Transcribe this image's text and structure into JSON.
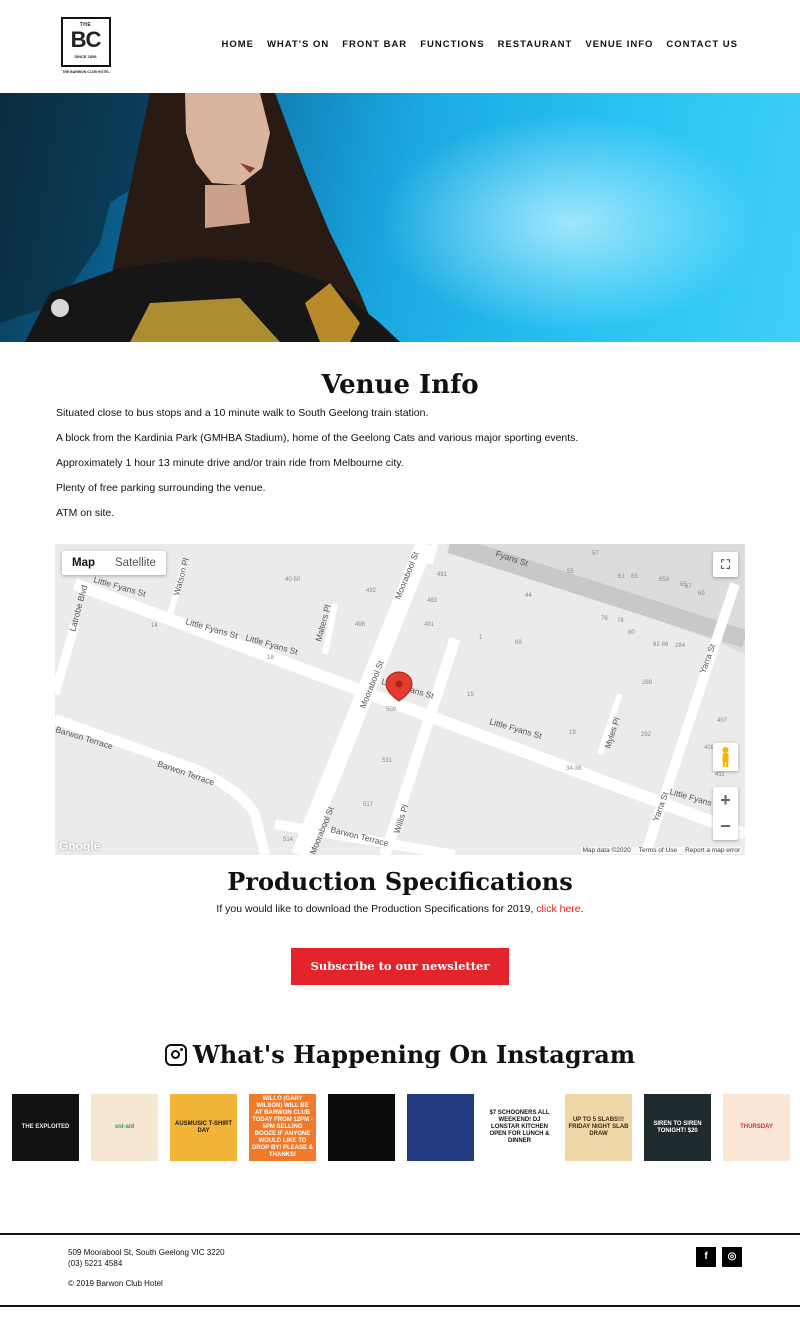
{
  "logo": {
    "the": "THE",
    "initials": "BC",
    "since": "SINCE 1856",
    "name": "THE BARWON CLUB HOTEL"
  },
  "nav": [
    "HOME",
    "WHAT'S ON",
    "FRONT BAR",
    "FUNCTIONS",
    "RESTAURANT",
    "VENUE INFO",
    "CONTACT US"
  ],
  "venue": {
    "title": "Venue Info",
    "paragraphs": [
      "Situated close to bus stops and a 10 minute walk to South Geelong train station.",
      "A block from the Kardinia Park (GMHBA Stadium), home of the Geelong Cats and various major sporting events.",
      "Approximately 1 hour 13 minute drive and/or train ride from Melbourne city.",
      "Plenty of free parking surrounding the venue.",
      "ATM on site."
    ]
  },
  "map": {
    "type_buttons": [
      "Map",
      "Satellite"
    ],
    "fullscreen_glyph": "⛶",
    "zoom_in": "+",
    "zoom_out": "−",
    "google": "Google",
    "footer": [
      "Map data ©2020",
      "Terms of Use",
      "Report a map error"
    ],
    "streets": [
      "Little Fyans St",
      "Little Fyans St",
      "Little Fyans St",
      "Little Fyans St",
      "Little Fyans St",
      "Little Fyans St",
      "Moorabool St",
      "Moorabool St",
      "Moorabool St",
      "Fyans St",
      "Yarra St",
      "Yarra St",
      "Barwon Terrace",
      "Barwon Terrace",
      "Barwon Terrace",
      "Latrobe Blvd",
      "Watson Pl",
      "Malters Pl",
      "Myles Pl",
      "Willis Pl"
    ],
    "numbers": [
      "57",
      "55",
      "61",
      "63",
      "65A",
      "65",
      "67",
      "69",
      "40-50",
      "492",
      "481",
      "483",
      "44",
      "498",
      "491",
      "14",
      "18",
      "76",
      "78",
      "80",
      "82-86",
      "284",
      "1",
      "68",
      "288",
      "15",
      "509",
      "19",
      "292",
      "407",
      "531",
      "34-38",
      "409",
      "411",
      "517",
      "514"
    ]
  },
  "production": {
    "title": "Production Specifications",
    "text": "If you would like to download the Production Specifications for 2019, ",
    "link": "click here",
    "end": "."
  },
  "subscribe": "Subscribe to our newsletter",
  "instagram": {
    "title": "What's Happening On Instagram",
    "tiles": [
      {
        "text": "THE EXPLOITED",
        "bg": "#111111",
        "fg": "#e8e8e8"
      },
      {
        "text": "sol-aid",
        "bg": "#f4e6cf",
        "fg": "#3f9a5d"
      },
      {
        "text": "AUSMUSIC T-SHIRT DAY",
        "bg": "#f2b436",
        "fg": "#1f1f1f"
      },
      {
        "text": "WILLO (GARY WILSON) WILL BE AT BARWON CLUB TODAY FROM 12PM - 5PM SELLING BOOZE IF ANYONE WOULD LIKE TO DROP BY! PLEASE & THANKS!",
        "bg": "#ef7a2c",
        "fg": "#ffffff"
      },
      {
        "text": "",
        "bg": "#0b0b0b",
        "fg": "#ffffff"
      },
      {
        "text": "",
        "bg": "#223a80",
        "fg": "#ffffff"
      },
      {
        "text": "$7 SCHOONERS ALL WEEKEND! DJ LONSTAR KITCHEN OPEN FOR LUNCH & DINNER",
        "bg": "#ffffff",
        "fg": "#111111"
      },
      {
        "text": "UP TO 5 SLABS!!! FRIDAY NIGHT SLAB DRAW",
        "bg": "#efd7a8",
        "fg": "#3a2a12"
      },
      {
        "text": "SIREN TO SIREN TONIGHT! $20",
        "bg": "#1e2a2e",
        "fg": "#ffffff"
      },
      {
        "text": "THURSDAY",
        "bg": "#fbe6d6",
        "fg": "#c9353b"
      }
    ]
  },
  "footer": {
    "address": "509 Moorabool St, South Geelong VIC 3220",
    "phone": "(03) 5221 4584",
    "copyright": "© 2019 Barwon Club Hotel",
    "social": [
      "f",
      "◎"
    ]
  }
}
